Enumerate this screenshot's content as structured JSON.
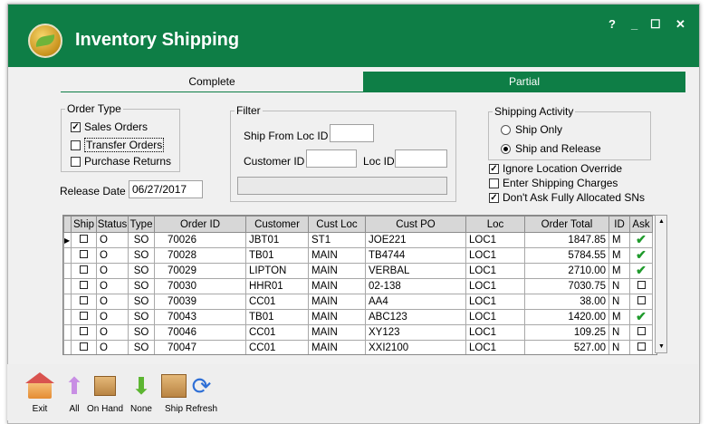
{
  "window": {
    "title": "Inventory Shipping",
    "controls": {
      "help": "?",
      "minimize": "_",
      "maximize": "☐",
      "close": "✕"
    }
  },
  "tabs": [
    {
      "label": "Complete",
      "active": true
    },
    {
      "label": "Partial",
      "active": false
    }
  ],
  "order_type": {
    "legend": "Order Type",
    "sales_orders": {
      "label": "Sales Orders",
      "checked": true
    },
    "transfer_orders": {
      "label": "Transfer Orders",
      "checked": false
    },
    "purchase_returns": {
      "label": "Purchase Returns",
      "checked": false
    }
  },
  "release_date": {
    "label": "Release Date",
    "value": "06/27/2017"
  },
  "filter": {
    "legend": "Filter",
    "ship_from_loc_label": "Ship From Loc ID",
    "ship_from_loc_value": "",
    "customer_id_label": "Customer ID",
    "customer_id_value": "",
    "loc_id_label": "Loc ID",
    "loc_id_value": "",
    "description_value": ""
  },
  "shipping_activity": {
    "legend": "Shipping Activity",
    "ship_only": {
      "label": "Ship Only",
      "selected": false
    },
    "ship_and_release": {
      "label": "Ship and Release",
      "selected": true
    }
  },
  "options": {
    "ignore_location_override": {
      "label": "Ignore Location Override",
      "checked": true
    },
    "enter_shipping_charges": {
      "label": "Enter Shipping Charges",
      "checked": false
    },
    "dont_ask_allocated": {
      "label": "Don't Ask Fully Allocated SNs",
      "checked": true
    }
  },
  "grid": {
    "columns": [
      "Ship",
      "Status",
      "Type",
      "Order ID",
      "Customer",
      "Cust Loc",
      "Cust PO",
      "Loc",
      "Order Total",
      "ID",
      "Ask"
    ],
    "rows": [
      {
        "status": "O",
        "type": "SO",
        "order_id": "70026",
        "customer": "JBT01",
        "cust_loc": "ST1",
        "cust_po": "JOE221",
        "loc": "LOC1",
        "order_total": "1847.85",
        "id": "M",
        "ask": true
      },
      {
        "status": "O",
        "type": "SO",
        "order_id": "70028",
        "customer": "TB01",
        "cust_loc": "MAIN",
        "cust_po": "TB4744",
        "loc": "LOC1",
        "order_total": "5784.55",
        "id": "M",
        "ask": true
      },
      {
        "status": "O",
        "type": "SO",
        "order_id": "70029",
        "customer": "LIPTON",
        "cust_loc": "MAIN",
        "cust_po": "VERBAL",
        "loc": "LOC1",
        "order_total": "2710.00",
        "id": "M",
        "ask": true
      },
      {
        "status": "O",
        "type": "SO",
        "order_id": "70030",
        "customer": "HHR01",
        "cust_loc": "MAIN",
        "cust_po": "02-138",
        "loc": "LOC1",
        "order_total": "7030.75",
        "id": "N",
        "ask": false
      },
      {
        "status": "O",
        "type": "SO",
        "order_id": "70039",
        "customer": "CC01",
        "cust_loc": "MAIN",
        "cust_po": "AA4",
        "loc": "LOC1",
        "order_total": "38.00",
        "id": "N",
        "ask": false
      },
      {
        "status": "O",
        "type": "SO",
        "order_id": "70043",
        "customer": "TB01",
        "cust_loc": "MAIN",
        "cust_po": "ABC123",
        "loc": "LOC1",
        "order_total": "1420.00",
        "id": "M",
        "ask": true
      },
      {
        "status": "O",
        "type": "SO",
        "order_id": "70046",
        "customer": "CC01",
        "cust_loc": "MAIN",
        "cust_po": "XY123",
        "loc": "LOC1",
        "order_total": "109.25",
        "id": "N",
        "ask": false
      },
      {
        "status": "O",
        "type": "SO",
        "order_id": "70047",
        "customer": "CC01",
        "cust_loc": "MAIN",
        "cust_po": "XXI2100",
        "loc": "LOC1",
        "order_total": "527.00",
        "id": "N",
        "ask": false
      }
    ]
  },
  "toolbar": [
    {
      "label": "Exit",
      "icon": "home-icon"
    },
    {
      "label": "All",
      "icon": "arrow-up-icon"
    },
    {
      "label": "On Hand",
      "icon": "package-hand-icon"
    },
    {
      "label": "None",
      "icon": "arrow-down-icon"
    },
    {
      "label": "Ship",
      "icon": "box-icon"
    },
    {
      "label": "Refresh",
      "icon": "refresh-icon"
    }
  ],
  "colors": {
    "accent": "#0e7e46",
    "check_green": "#1f9a2c"
  }
}
